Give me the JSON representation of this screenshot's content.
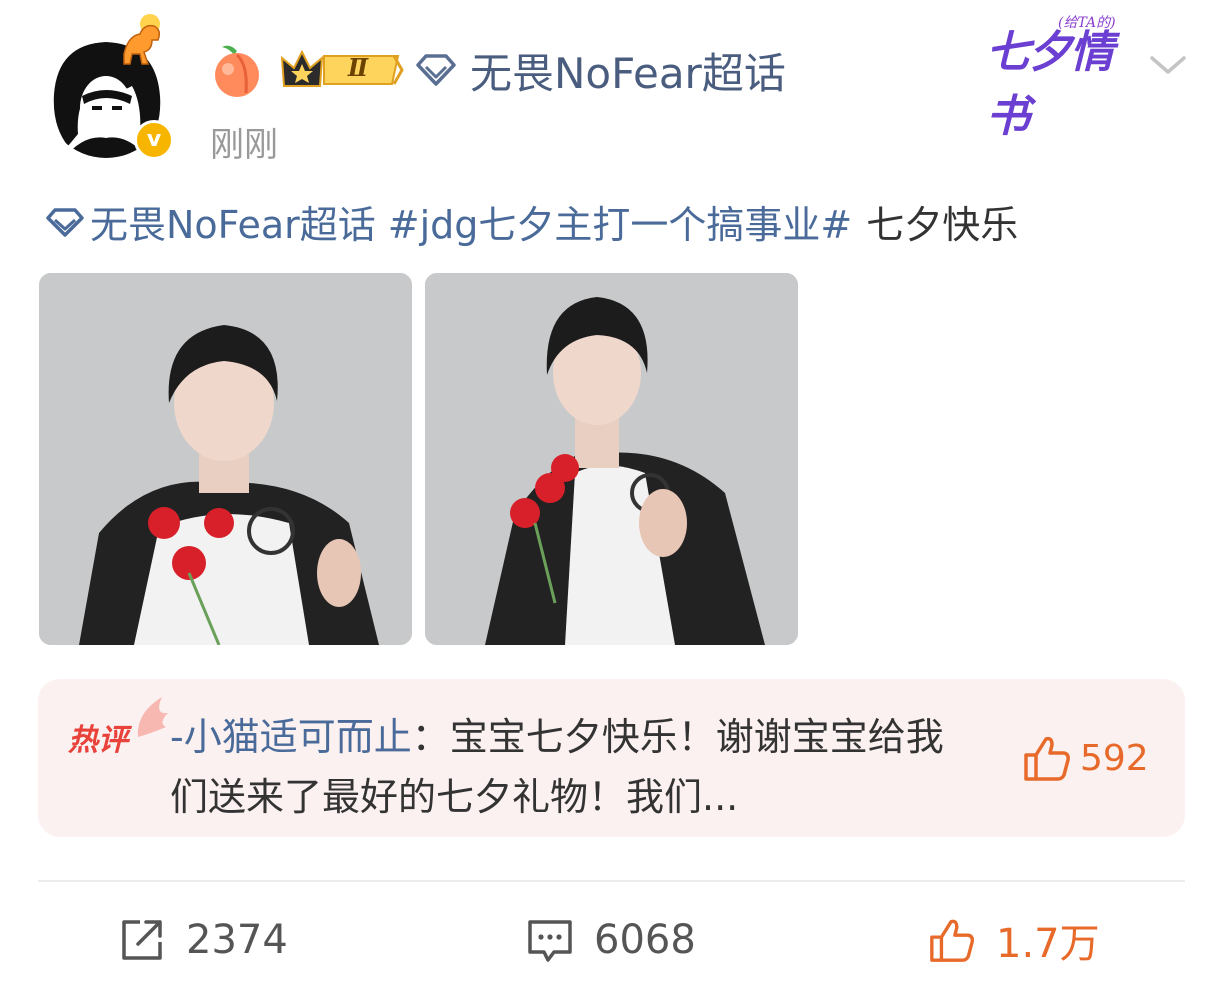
{
  "post": {
    "author": {
      "name": "无畏NoFear超话",
      "vip_level": "Ⅱ",
      "verified_mark": "v"
    },
    "timestamp": "刚刚",
    "campaign": {
      "title": "七夕情书",
      "subtitle": "(给TA的)"
    },
    "content": {
      "topic": "无畏NoFear超话",
      "hashtag": "#jdg七夕主打一个搞事业#",
      "text": "七夕快乐"
    },
    "photos": [
      {
        "name": "photo-1"
      },
      {
        "name": "photo-2"
      }
    ]
  },
  "hot_comment": {
    "label": "热评",
    "commenter": "-小猫适可而止",
    "separator": "：",
    "text": "宝宝七夕快乐！谢谢宝宝给我们送来了最好的七夕礼物！我们...",
    "likes": "592"
  },
  "actions": {
    "repost_count": "2374",
    "comment_count": "6068",
    "like_count": "1.7万"
  },
  "colors": {
    "link": "#4a6b9a",
    "accent_orange": "#e86a2a",
    "hot_red": "#e8423a",
    "comment_bg": "#fbf1f0"
  },
  "icons": [
    "horse-icon",
    "verified-badge",
    "peach-icon",
    "crown-icon",
    "diamond-icon",
    "chevron-down-icon",
    "thumbs-up-icon",
    "repost-icon",
    "comment-icon"
  ]
}
